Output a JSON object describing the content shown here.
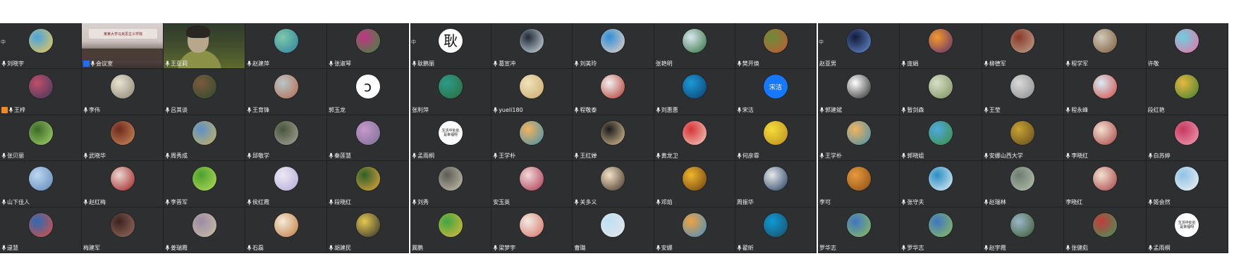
{
  "panels": [
    {
      "corner_text": "中",
      "tiles": [
        {
          "name": "刘晓宇",
          "mic": true,
          "avatar": {
            "kind": "color",
            "colors": [
              "#4aa3df",
              "#f2c94c"
            ]
          }
        },
        {
          "name": "会议室",
          "mic": true,
          "host": "blue",
          "video": "room",
          "room_banner": "某某大学马克思主义学院"
        },
        {
          "name": "王亚莉",
          "mic": true,
          "video": "person"
        },
        {
          "name": "赵建萍",
          "mic": true,
          "avatar": {
            "kind": "color",
            "colors": [
              "#7fc8a9",
              "#2d7f9e"
            ]
          }
        },
        {
          "name": "张淑琴",
          "mic": true,
          "avatar": {
            "kind": "color",
            "colors": [
              "#c13584",
              "#3a8d3a"
            ]
          }
        },
        {
          "name": "王梓",
          "mic": true,
          "host": "orange",
          "avatar": {
            "kind": "color",
            "colors": [
              "#c24d6a",
              "#3a3a58"
            ]
          }
        },
        {
          "name": "李伟",
          "mic": true,
          "avatar": {
            "kind": "color",
            "colors": [
              "#e8e2d2",
              "#8b8370"
            ]
          }
        },
        {
          "name": "吕其谈",
          "mic": true,
          "avatar": {
            "kind": "color",
            "colors": [
              "#7b5a3c",
              "#2e4a2e"
            ]
          }
        },
        {
          "name": "王育锋",
          "mic": true,
          "avatar": {
            "kind": "color",
            "colors": [
              "#b9c6c9",
              "#b36a4c"
            ]
          }
        },
        {
          "name": "郭玉龙",
          "mic": false,
          "avatar": {
            "kind": "white",
            "text": "ↄ"
          }
        },
        {
          "name": "张贝丽",
          "mic": true,
          "avatar": {
            "kind": "color",
            "colors": [
              "#3c6b2a",
              "#a3d36b"
            ]
          }
        },
        {
          "name": "武晓华",
          "mic": true,
          "avatar": {
            "kind": "color",
            "colors": [
              "#6d2a1f",
              "#d08d5b"
            ]
          }
        },
        {
          "name": "周秀成",
          "mic": true,
          "avatar": {
            "kind": "color",
            "colors": [
              "#5d91c7",
              "#c9b35b"
            ]
          }
        },
        {
          "name": "邱敬学",
          "mic": true,
          "avatar": {
            "kind": "color",
            "colors": [
              "#49543c",
              "#a7a79a"
            ]
          }
        },
        {
          "name": "秦莲慧",
          "mic": true,
          "avatar": {
            "kind": "color",
            "colors": [
              "#c69ac9",
              "#7a6c95"
            ]
          }
        },
        {
          "name": "山下佳人",
          "mic": true,
          "avatar": {
            "kind": "color",
            "colors": [
              "#bcd8f2",
              "#5f86b6"
            ]
          }
        },
        {
          "name": "赵红梅",
          "mic": true,
          "avatar": {
            "kind": "color",
            "colors": [
              "#e9d8d2",
              "#a31a1a"
            ]
          }
        },
        {
          "name": "李晋军",
          "mic": true,
          "avatar": {
            "kind": "color",
            "colors": [
              "#4ba12d",
              "#b7dc5b"
            ]
          }
        },
        {
          "name": "侯红霞",
          "mic": true,
          "avatar": {
            "kind": "color",
            "colors": [
              "#ece9f6",
              "#b4a8d6"
            ]
          }
        },
        {
          "name": "段晓红",
          "mic": true,
          "avatar": {
            "kind": "color",
            "colors": [
              "#2f5f2a",
              "#e8a93a"
            ]
          }
        },
        {
          "name": "逯慧",
          "mic": true,
          "avatar": {
            "kind": "color",
            "colors": [
              "#2c6bb3",
              "#e24c3d"
            ]
          }
        },
        {
          "name": "梅建军",
          "mic": false,
          "avatar": {
            "kind": "color",
            "colors": [
              "#3a2220",
              "#9b6f5e"
            ]
          }
        },
        {
          "name": "姜瑞霞",
          "mic": true,
          "avatar": {
            "kind": "color",
            "colors": [
              "#9d8aa4",
              "#c8c2a6"
            ]
          }
        },
        {
          "name": "石磊",
          "mic": true,
          "avatar": {
            "kind": "color",
            "colors": [
              "#f3ead8",
              "#c0793b"
            ]
          }
        },
        {
          "name": "胡建民",
          "mic": true,
          "avatar": {
            "kind": "color",
            "colors": [
              "#e3c84e",
              "#2d2d2d"
            ]
          }
        }
      ]
    },
    {
      "corner_text": "中",
      "tiles": [
        {
          "name": "耿鹏丽",
          "mic": true,
          "avatar": {
            "kind": "white",
            "text": "耿"
          }
        },
        {
          "name": "葛宣冲",
          "mic": true,
          "avatar": {
            "kind": "color",
            "colors": [
              "#1e2a36",
              "#d9e2ea"
            ]
          }
        },
        {
          "name": "刘美玲",
          "mic": true,
          "avatar": {
            "kind": "color",
            "colors": [
              "#2f8fd6",
              "#f1d4c2"
            ]
          }
        },
        {
          "name": "张艳明",
          "mic": false,
          "avatar": {
            "kind": "color",
            "colors": [
              "#d9e6ee",
              "#2d6e3d"
            ]
          }
        },
        {
          "name": "樊开焕",
          "mic": true,
          "avatar": {
            "kind": "color",
            "colors": [
              "#6a8c3b",
              "#c45a35"
            ]
          }
        },
        {
          "name": "张利萍",
          "mic": false,
          "avatar": {
            "kind": "color",
            "colors": [
              "#2d9a8a",
              "#2c6d3c"
            ]
          }
        },
        {
          "name": "yueli180",
          "mic": true,
          "avatar": {
            "kind": "color",
            "colors": [
              "#f1e3bd",
              "#caa769"
            ]
          }
        },
        {
          "name": "程敬泰",
          "mic": true,
          "avatar": {
            "kind": "color",
            "colors": [
              "#f2f2f2",
              "#b3342a"
            ]
          }
        },
        {
          "name": "刘惠惠",
          "mic": true,
          "avatar": {
            "kind": "color",
            "colors": [
              "#1a9ad6",
              "#0d3d6b"
            ]
          }
        },
        {
          "name": "宋洁",
          "mic": true,
          "avatar": {
            "kind": "text",
            "text": "宋洁",
            "colors": [
              "#1677ff",
              "#1677ff"
            ]
          }
        },
        {
          "name": "孟雨桐",
          "mic": true,
          "avatar": {
            "kind": "white",
            "text": "生活中处处\n是幸福呀"
          }
        },
        {
          "name": "王学朴",
          "mic": true,
          "avatar": {
            "kind": "color",
            "colors": [
              "#f2b35e",
              "#3f8fb0"
            ]
          }
        },
        {
          "name": "王红婵",
          "mic": true,
          "avatar": {
            "kind": "color",
            "colors": [
              "#1a1a1a",
              "#e0c79b"
            ]
          }
        },
        {
          "name": "黄龙卫",
          "mic": true,
          "avatar": {
            "kind": "color",
            "colors": [
              "#d6353a",
              "#f2d1c0"
            ]
          }
        },
        {
          "name": "何彦霏",
          "mic": true,
          "avatar": {
            "kind": "color",
            "colors": [
              "#f6dd3b",
              "#b98b1d"
            ]
          }
        },
        {
          "name": "刘秀",
          "mic": true,
          "avatar": {
            "kind": "color",
            "colors": [
              "#5d5d55",
              "#c7c1b0"
            ]
          }
        },
        {
          "name": "安玉英",
          "mic": false,
          "avatar": {
            "kind": "color",
            "colors": [
              "#f2dada",
              "#a8334a"
            ]
          }
        },
        {
          "name": "关多义",
          "mic": true,
          "avatar": {
            "kind": "color",
            "colors": [
              "#f5e1c6",
              "#3b2d22"
            ]
          }
        },
        {
          "name": "邓焰",
          "mic": true,
          "avatar": {
            "kind": "color",
            "colors": [
              "#f0b52a",
              "#6b3f12"
            ]
          }
        },
        {
          "name": "周振华",
          "mic": false,
          "avatar": {
            "kind": "color",
            "colors": [
              "#e5e8ea",
              "#1f3a5e"
            ]
          }
        },
        {
          "name": "冀鹏",
          "mic": false,
          "avatar": {
            "kind": "color",
            "colors": [
              "#3fa642",
              "#e2b83a"
            ]
          }
        },
        {
          "name": "梁梦宇",
          "mic": true,
          "avatar": {
            "kind": "color",
            "colors": [
              "#f0ece4",
              "#d86e62"
            ]
          }
        },
        {
          "name": "曹璐",
          "mic": false,
          "avatar": {
            "kind": "color",
            "colors": [
              "#bfe0f5",
              "#e5e5e5"
            ]
          }
        },
        {
          "name": "安娜",
          "mic": true,
          "avatar": {
            "kind": "color",
            "colors": [
              "#f0a241",
              "#3c8fc8"
            ]
          }
        },
        {
          "name": "翟昕",
          "mic": true,
          "avatar": {
            "kind": "color",
            "colors": [
              "#0e9ad4",
              "#1c4c64"
            ]
          }
        }
      ]
    },
    {
      "corner_text": "中",
      "tiles": [
        {
          "name": "赵亚男",
          "mic": false,
          "avatar": {
            "kind": "color",
            "colors": [
              "#101a3a",
              "#6b8fd1"
            ]
          }
        },
        {
          "name": "庞娟",
          "mic": true,
          "avatar": {
            "kind": "color",
            "colors": [
              "#f39a2c",
              "#5a2c72"
            ]
          }
        },
        {
          "name": "柳德军",
          "mic": true,
          "avatar": {
            "kind": "color",
            "colors": [
              "#8a3a2a",
              "#bfa58f"
            ]
          }
        },
        {
          "name": "程学军",
          "mic": true,
          "avatar": {
            "kind": "color",
            "colors": [
              "#d0c9b8",
              "#7a5a3b"
            ]
          }
        },
        {
          "name": "许敬",
          "mic": false,
          "avatar": {
            "kind": "color",
            "colors": [
              "#6cd0e0",
              "#f16fa3"
            ]
          }
        },
        {
          "name": "郭建斌",
          "mic": true,
          "avatar": {
            "kind": "color",
            "colors": [
              "#ffffff",
              "#222222"
            ]
          }
        },
        {
          "name": "暂剑森",
          "mic": true,
          "avatar": {
            "kind": "color",
            "colors": [
              "#d6dfc7",
              "#7b8f5a"
            ]
          }
        },
        {
          "name": "王莹",
          "mic": true,
          "avatar": {
            "kind": "color",
            "colors": [
              "#d9d9d9",
              "#8c8c8c"
            ]
          }
        },
        {
          "name": "程永峰",
          "mic": true,
          "avatar": {
            "kind": "color",
            "colors": [
              "#d7ecf7",
              "#d2463b"
            ]
          }
        },
        {
          "name": "段红艳",
          "mic": false,
          "avatar": {
            "kind": "color",
            "colors": [
              "#e8b73f",
              "#3c7f2f"
            ]
          }
        },
        {
          "name": "王学朴",
          "mic": true,
          "avatar": {
            "kind": "color",
            "colors": [
              "#f2b35e",
              "#3f8fb0"
            ]
          }
        },
        {
          "name": "郭晓姐",
          "mic": true,
          "avatar": {
            "kind": "color",
            "colors": [
              "#4fa8e0",
              "#3b8e3b"
            ]
          }
        },
        {
          "name": "安娜山西大学",
          "mic": true,
          "avatar": {
            "kind": "color",
            "colors": [
              "#c8a234",
              "#5f4a1d"
            ]
          }
        },
        {
          "name": "李晓红",
          "mic": true,
          "avatar": {
            "kind": "color",
            "colors": [
              "#f2e1d0",
              "#a33f3f"
            ]
          }
        },
        {
          "name": "白苏婷",
          "mic": true,
          "avatar": {
            "kind": "color",
            "colors": [
              "#c7375f",
              "#f0a3b5"
            ]
          }
        },
        {
          "name": "李可",
          "mic": false,
          "avatar": {
            "kind": "color",
            "colors": [
              "#e89a3b",
              "#8a4d16"
            ]
          }
        },
        {
          "name": "张守夫",
          "mic": true,
          "avatar": {
            "kind": "color",
            "colors": [
              "#2b8ec1",
              "#e6f1f7"
            ]
          }
        },
        {
          "name": "赵瑞林",
          "mic": true,
          "avatar": {
            "kind": "color",
            "colors": [
              "#6c7c6e",
              "#b8c3b2"
            ]
          }
        },
        {
          "name": "李晓红",
          "mic": false,
          "avatar": {
            "kind": "color",
            "colors": [
              "#f2e1d0",
              "#a33f3f"
            ]
          }
        },
        {
          "name": "姬会然",
          "mic": true,
          "avatar": {
            "kind": "color",
            "colors": [
              "#8fc2e4",
              "#f3f3f3"
            ]
          }
        },
        {
          "name": "罗华志",
          "mic": false,
          "avatar": {
            "kind": "color",
            "colors": [
              "#3e76c2",
              "#8fbf5a"
            ]
          }
        },
        {
          "name": "罗华志",
          "mic": true,
          "avatar": {
            "kind": "color",
            "colors": [
              "#3e76c2",
              "#8fbf5a"
            ]
          }
        },
        {
          "name": "赵宇霞",
          "mic": true,
          "avatar": {
            "kind": "color",
            "colors": [
              "#9bb6c9",
              "#3b5a2e"
            ]
          }
        },
        {
          "name": "张健彪",
          "mic": true,
          "avatar": {
            "kind": "color",
            "colors": [
              "#c33b3b",
              "#3a9a58"
            ]
          }
        },
        {
          "name": "孟雨桐",
          "mic": true,
          "avatar": {
            "kind": "white",
            "text": "生活中处处\n是幸福呀"
          }
        }
      ]
    }
  ]
}
